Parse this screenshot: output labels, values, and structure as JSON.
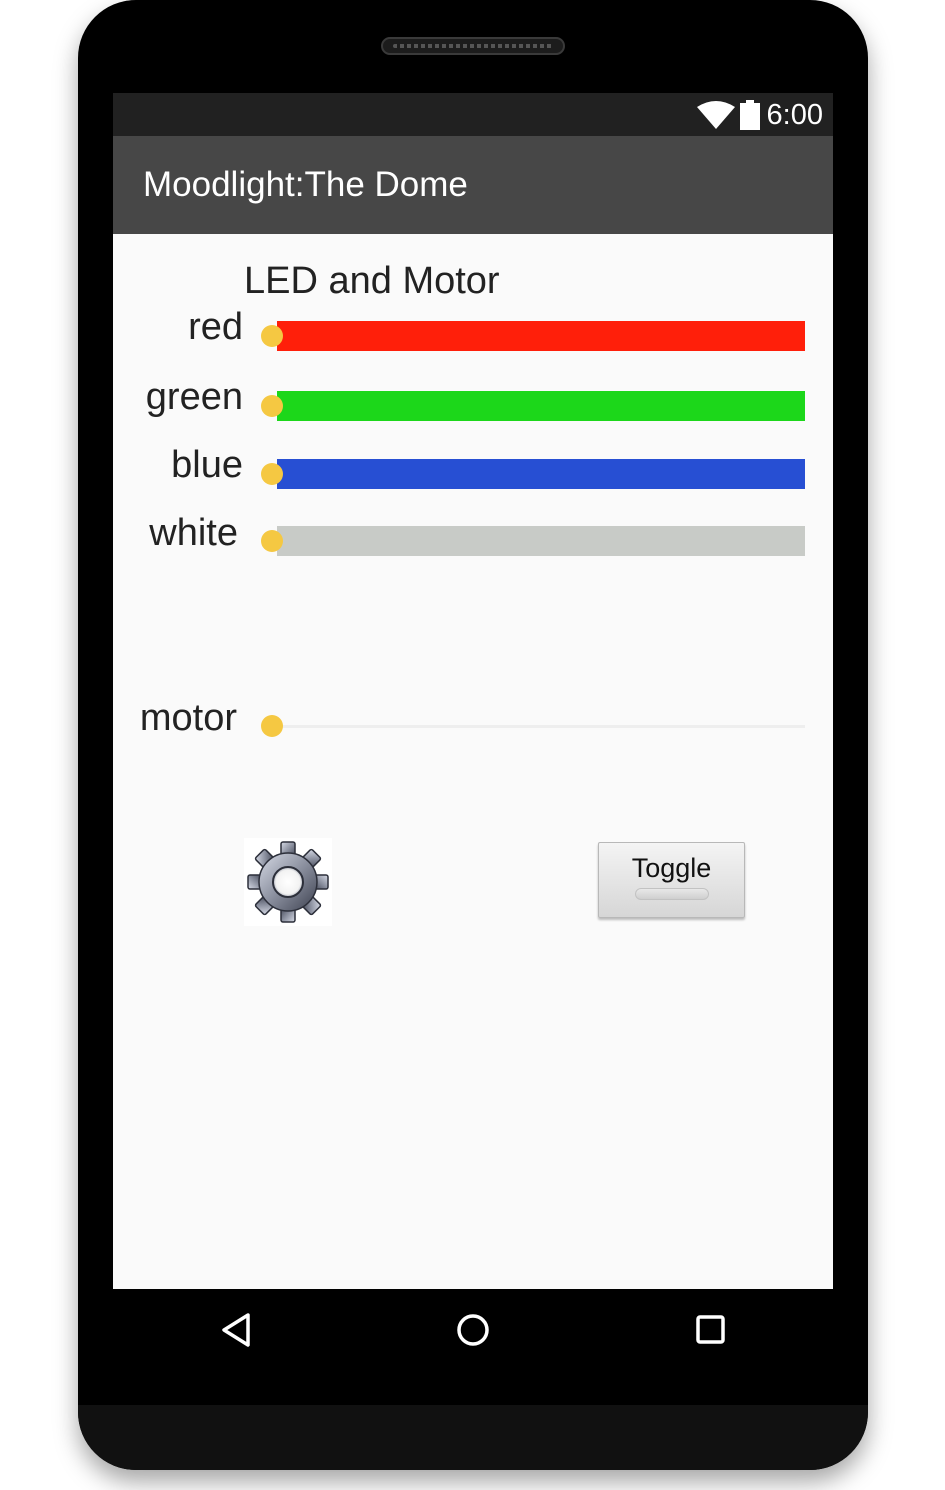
{
  "status_bar": {
    "time": "6:00",
    "icons": [
      "wifi-icon",
      "battery-icon"
    ]
  },
  "app_bar": {
    "title": "Moodlight:The Dome"
  },
  "main": {
    "header": "LED and Motor",
    "sliders": [
      {
        "label": "red",
        "color": "#ff1f0a",
        "value": 0
      },
      {
        "label": "green",
        "color": "#1cd71a",
        "value": 0
      },
      {
        "label": "blue",
        "color": "#274fd3",
        "value": 0
      },
      {
        "label": "white",
        "color": "#c8cbc7",
        "value": 0
      }
    ],
    "motor": {
      "label": "motor",
      "value": 0
    },
    "settings_icon": "gear-icon",
    "toggle_button": {
      "label": "Toggle"
    }
  },
  "navigation": {
    "buttons": [
      "back-icon",
      "home-icon",
      "recents-icon"
    ]
  },
  "colors": {
    "thumb": "#f5c842",
    "app_bar": "#474747",
    "status_bar": "#212121",
    "screen_background": "#fafafa"
  }
}
